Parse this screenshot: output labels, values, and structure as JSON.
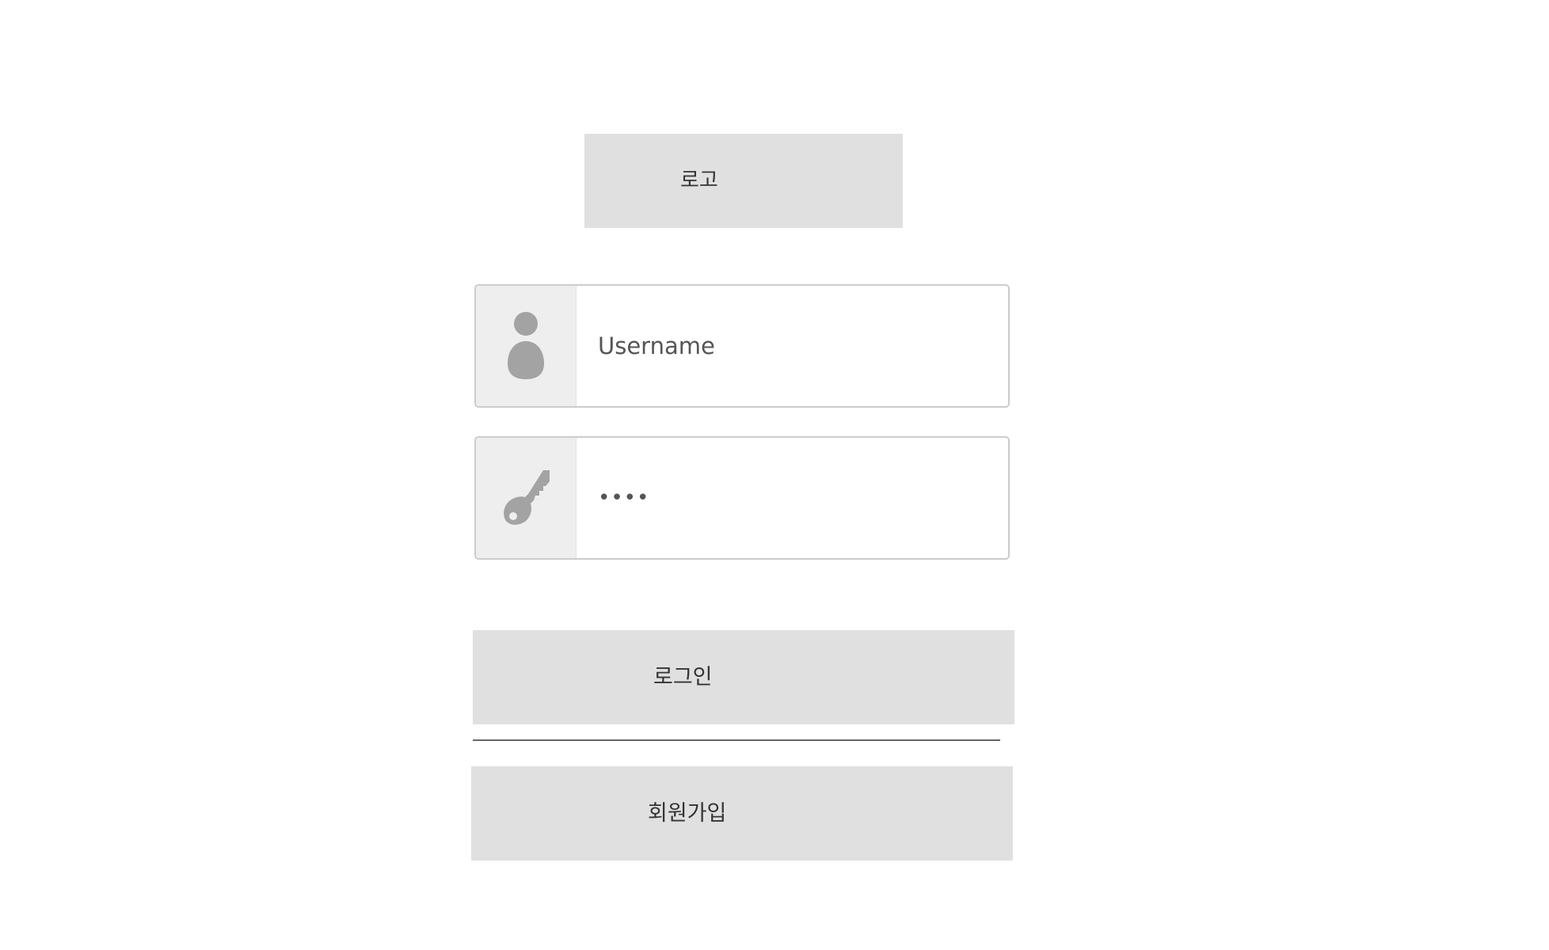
{
  "logo": {
    "text": "로고"
  },
  "username_field": {
    "icon": "user-icon",
    "placeholder": "Username",
    "value": ""
  },
  "password_field": {
    "icon": "key-icon",
    "value": "••••"
  },
  "login_button": {
    "label": "로그인"
  },
  "signup_button": {
    "label": "회원가입"
  },
  "colors": {
    "button_bg": "#e0e0e0",
    "icon": "#a3a3a3",
    "icon_cell_bg": "#eeeeee",
    "field_border": "#cccccc",
    "divider": "#666666"
  }
}
